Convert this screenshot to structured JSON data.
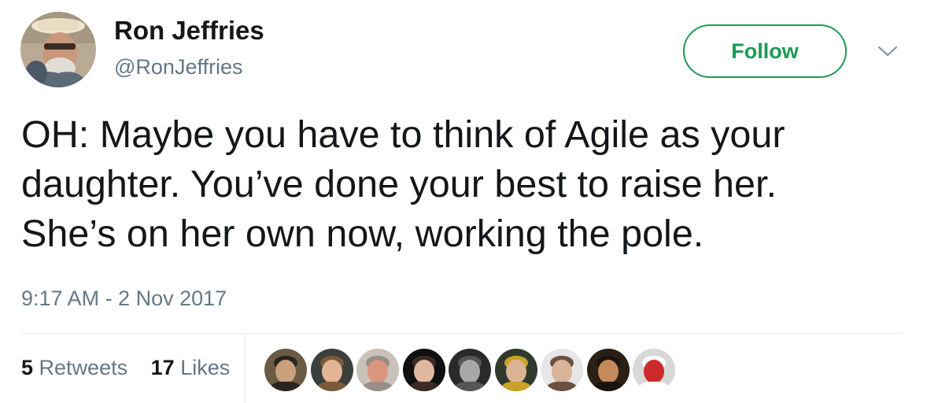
{
  "author": {
    "display_name": "Ron Jeffries",
    "handle": "@RonJeffries",
    "avatar_icon": "profile-photo"
  },
  "follow_button": {
    "label": "Follow",
    "color": "#1b9a55"
  },
  "menu_icon": "chevron-down-icon",
  "tweet": {
    "lines": [
      "OH: Maybe you have to think of Agile as your",
      "daughter. You’ve done your best to raise her.",
      "She’s on her own now, working the pole."
    ]
  },
  "timestamp": "9:17 AM - 2 Nov 2017",
  "stats": {
    "retweets_count": "5",
    "retweets_label": "Retweets",
    "likes_count": "17",
    "likes_label": "Likes"
  },
  "likers": [
    {
      "icon": "liker-avatar-1",
      "bg": "#6b5a44",
      "face": "#c8a07c",
      "hair": "#2a2420"
    },
    {
      "icon": "liker-avatar-2",
      "bg": "#3a3f3b",
      "face": "#e3b596",
      "hair": "#7a5a3a"
    },
    {
      "icon": "liker-avatar-3",
      "bg": "#c9c2b8",
      "face": "#d9957e",
      "hair": "#9a8f88"
    },
    {
      "icon": "liker-avatar-4",
      "bg": "#101010",
      "face": "#e0b8a0",
      "hair": "#3a2c24"
    },
    {
      "icon": "liker-avatar-5",
      "bg": "#2a2a2a",
      "face": "#a8a8a8",
      "hair": "#555555"
    },
    {
      "icon": "liker-avatar-6",
      "bg": "#2f3a2a",
      "face": "#dcb394",
      "hair": "#c9a227"
    },
    {
      "icon": "liker-avatar-7",
      "bg": "#e6e6e6",
      "face": "#d8b49a",
      "hair": "#6a5040"
    },
    {
      "icon": "liker-avatar-8",
      "bg": "#2b2016",
      "face": "#c48a5c",
      "hair": "#1a1410"
    },
    {
      "icon": "liker-avatar-9",
      "bg": "#d8d8d8",
      "face": "#cc2b2b",
      "hair": "#ffffff"
    }
  ]
}
